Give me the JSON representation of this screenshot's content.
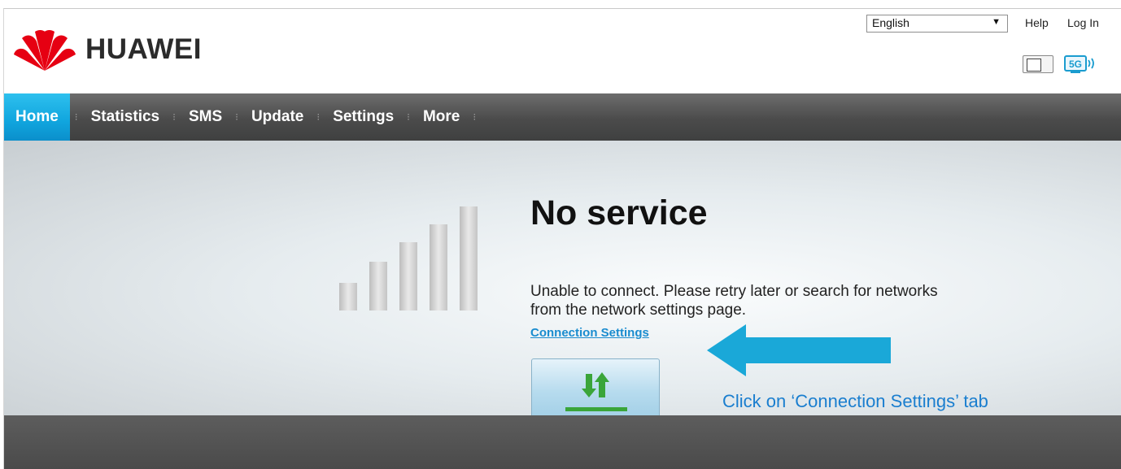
{
  "header": {
    "brand": "HUAWEI",
    "language": "English",
    "help_label": "Help",
    "login_label": "Log In",
    "status_5g": "5G"
  },
  "nav": {
    "items": [
      {
        "label": "Home",
        "active": true
      },
      {
        "label": "Statistics"
      },
      {
        "label": "SMS"
      },
      {
        "label": "Update"
      },
      {
        "label": "Settings"
      },
      {
        "label": "More"
      }
    ]
  },
  "main": {
    "title": "No service",
    "message": "Unable to connect. Please retry later or search for networks from the network settings page.",
    "connection_link": "Connection Settings",
    "callout": "Click on ‘Connection Settings’ tab"
  },
  "colors": {
    "accent": "#10a5de",
    "link": "#1a8ccf",
    "callout": "#1a9ccf",
    "brand_red": "#e60012"
  }
}
